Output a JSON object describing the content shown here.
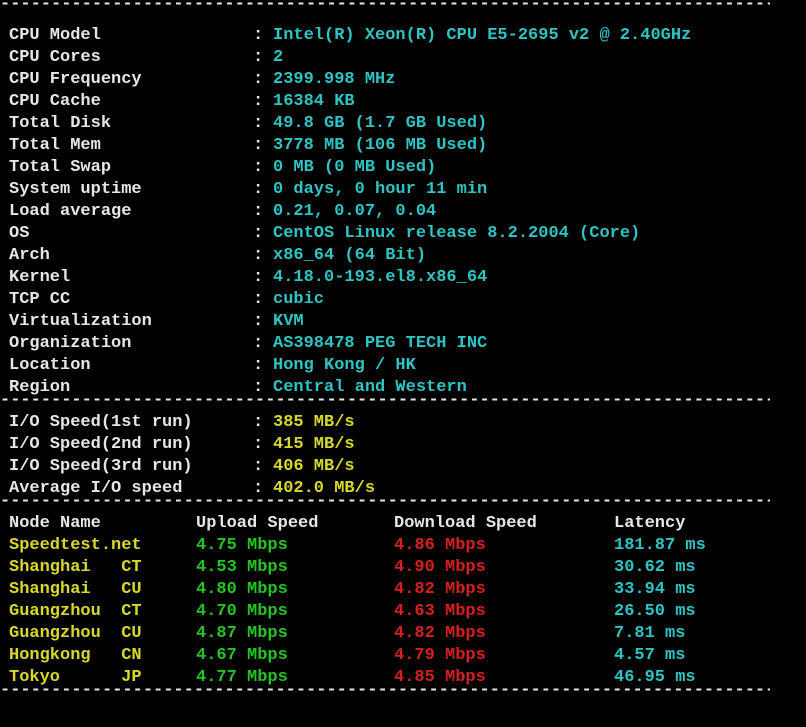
{
  "divider": "------------------------------------------------------------------------------------------------------------------",
  "system_info": [
    {
      "label": "CPU Model",
      "value": "Intel(R) Xeon(R) CPU E5-2695 v2 @ 2.40GHz"
    },
    {
      "label": "CPU Cores",
      "value": "2"
    },
    {
      "label": "CPU Frequency",
      "value": "2399.998 MHz"
    },
    {
      "label": "CPU Cache",
      "value": "16384 KB"
    },
    {
      "label": "Total Disk",
      "value": "49.8 GB (1.7 GB Used)"
    },
    {
      "label": "Total Mem",
      "value": "3778 MB (106 MB Used)"
    },
    {
      "label": "Total Swap",
      "value": "0 MB (0 MB Used)"
    },
    {
      "label": "System uptime",
      "value": "0 days, 0 hour 11 min"
    },
    {
      "label": "Load average",
      "value": "0.21, 0.07, 0.04"
    },
    {
      "label": "OS",
      "value": "CentOS Linux release 8.2.2004 (Core)"
    },
    {
      "label": "Arch",
      "value": "x86_64 (64 Bit)"
    },
    {
      "label": "Kernel",
      "value": "4.18.0-193.el8.x86_64"
    },
    {
      "label": "TCP CC",
      "value": "cubic"
    },
    {
      "label": "Virtualization",
      "value": "KVM"
    },
    {
      "label": "Organization",
      "value": "AS398478 PEG TECH INC"
    },
    {
      "label": "Location",
      "value": "Hong Kong / HK"
    },
    {
      "label": "Region",
      "value": "Central and Western"
    }
  ],
  "io_info": [
    {
      "label": "I/O Speed(1st run)",
      "value": "385 MB/s"
    },
    {
      "label": "I/O Speed(2nd run)",
      "value": "415 MB/s"
    },
    {
      "label": "I/O Speed(3rd run)",
      "value": "406 MB/s"
    },
    {
      "label": "Average I/O speed",
      "value": "402.0 MB/s"
    }
  ],
  "speed_header": {
    "node": "Node Name",
    "upload": "Upload Speed",
    "download": "Download Speed",
    "latency": "Latency"
  },
  "speed_rows": [
    {
      "node": "Speedtest.net",
      "upload": "4.75 Mbps",
      "download": "4.86 Mbps",
      "latency": "181.87 ms"
    },
    {
      "node": "Shanghai   CT",
      "upload": "4.53 Mbps",
      "download": "4.90 Mbps",
      "latency": "30.62 ms"
    },
    {
      "node": "Shanghai   CU",
      "upload": "4.80 Mbps",
      "download": "4.82 Mbps",
      "latency": "33.94 ms"
    },
    {
      "node": "Guangzhou  CT",
      "upload": "4.70 Mbps",
      "download": "4.63 Mbps",
      "latency": "26.50 ms"
    },
    {
      "node": "Guangzhou  CU",
      "upload": "4.87 Mbps",
      "download": "4.82 Mbps",
      "latency": "7.81 ms"
    },
    {
      "node": "Hongkong   CN",
      "upload": "4.67 Mbps",
      "download": "4.79 Mbps",
      "latency": "4.57 ms"
    },
    {
      "node": "Tokyo      JP",
      "upload": "4.77 Mbps",
      "download": "4.85 Mbps",
      "latency": "46.95 ms"
    }
  ],
  "separator_char": ":",
  "colors": {
    "label": "#e6e6e6",
    "info_value": "#2ec4c4",
    "io_value": "#d8d82a",
    "node": "#d8d82a",
    "upload": "#25c425",
    "download": "#d42020",
    "latency": "#2ec4c4"
  }
}
